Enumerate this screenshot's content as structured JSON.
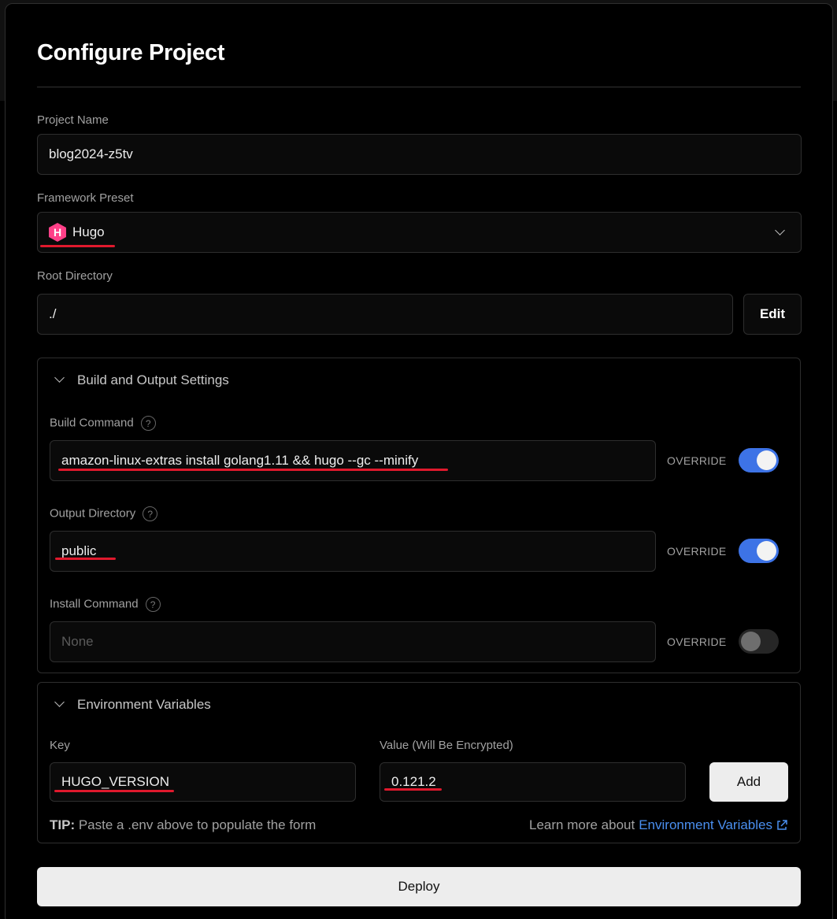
{
  "page_title": "Configure Project",
  "project_name": {
    "label": "Project Name",
    "value": "blog2024-z5tv"
  },
  "framework_preset": {
    "label": "Framework Preset",
    "icon_letter": "H",
    "value": "Hugo"
  },
  "root_directory": {
    "label": "Root Directory",
    "value": "./",
    "edit_label": "Edit"
  },
  "build_settings": {
    "title": "Build and Output Settings",
    "build_command": {
      "label": "Build Command",
      "value": "amazon-linux-extras install golang1.11 && hugo --gc --minify",
      "override_label": "OVERRIDE",
      "override_on": true
    },
    "output_directory": {
      "label": "Output Directory",
      "value": "public",
      "override_label": "OVERRIDE",
      "override_on": true
    },
    "install_command": {
      "label": "Install Command",
      "placeholder": "None",
      "override_label": "OVERRIDE",
      "override_on": false
    },
    "help_glyph": "?"
  },
  "env_vars": {
    "title": "Environment Variables",
    "key_label": "Key",
    "value_label": "Value (Will Be Encrypted)",
    "key_value": "HUGO_VERSION",
    "value_value": "0.121.2",
    "add_label": "Add",
    "tip_bold": "TIP:",
    "tip_text": "Paste a .env above to populate the form",
    "learn_prefix": "Learn more about",
    "learn_link": "Environment Variables"
  },
  "deploy_label": "Deploy",
  "colors": {
    "toggle_on": "#3d73e6",
    "link": "#4a8ff0",
    "annotation": "#e0192d",
    "hugo": "#ff4088"
  }
}
